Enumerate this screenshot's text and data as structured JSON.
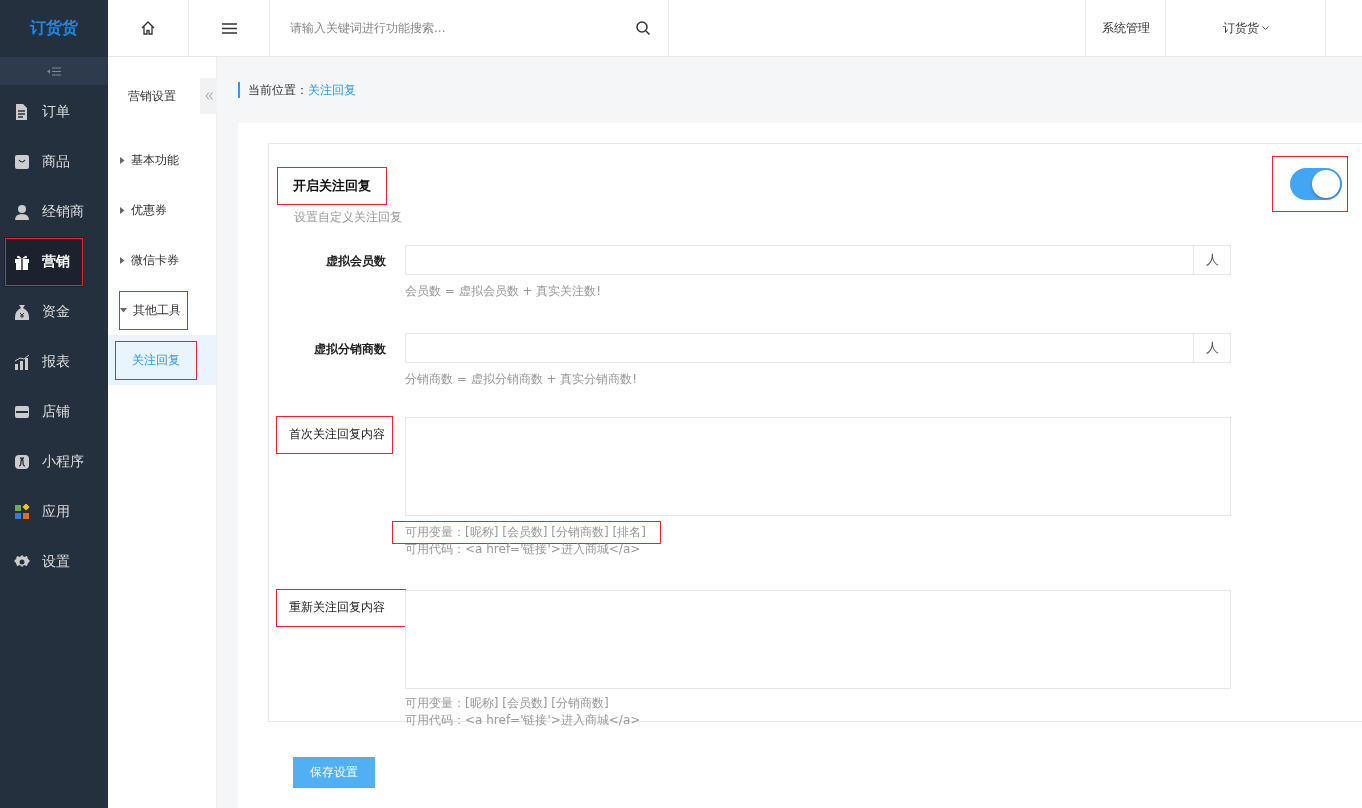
{
  "logo": "订货货",
  "sidebar": {
    "items": [
      {
        "label": "订单",
        "selected": false,
        "highlighted": false
      },
      {
        "label": "商品",
        "selected": false,
        "highlighted": false
      },
      {
        "label": "经销商",
        "selected": false,
        "highlighted": false
      },
      {
        "label": "营销",
        "selected": true,
        "highlighted": true
      },
      {
        "label": "资金",
        "selected": false,
        "highlighted": false
      },
      {
        "label": "报表",
        "selected": false,
        "highlighted": false
      },
      {
        "label": "店铺",
        "selected": false,
        "highlighted": false
      },
      {
        "label": "小程序",
        "selected": false,
        "highlighted": false
      },
      {
        "label": "应用",
        "selected": false,
        "highlighted": false
      },
      {
        "label": "设置",
        "selected": false,
        "highlighted": false
      }
    ]
  },
  "topbar": {
    "search": {
      "placeholder": "请输入关键词进行功能搜索..."
    },
    "links": [
      {
        "label": "系统管理",
        "dropdown": false
      },
      {
        "label": "订货货",
        "dropdown": true
      }
    ]
  },
  "submenu": {
    "title": "营销设置",
    "groups": [
      {
        "label": "基本功能",
        "expanded": false,
        "highlighted": false
      },
      {
        "label": "优惠券",
        "expanded": false,
        "highlighted": false
      },
      {
        "label": "微信卡券",
        "expanded": false,
        "highlighted": false
      },
      {
        "label": "其他工具",
        "expanded": true,
        "highlighted": true,
        "children": [
          {
            "label": "关注回复",
            "selected": true,
            "highlighted": true
          }
        ]
      }
    ]
  },
  "breadcrumb": {
    "label": "当前位置：",
    "current": "关注回复"
  },
  "section": {
    "title": "开启关注回复",
    "title_highlighted": true,
    "subtitle": "设置自定义关注回复",
    "toggle": {
      "on": true,
      "highlighted": true
    }
  },
  "fields": [
    {
      "kind": "number",
      "label": "虚拟会员数",
      "label_highlighted": false,
      "unit": "人",
      "hints": [
        {
          "text": "会员数 = 虚拟会员数 + 真实关注数!",
          "highlighted": false
        }
      ]
    },
    {
      "kind": "number",
      "label": "虚拟分销商数",
      "label_highlighted": false,
      "unit": "人",
      "hints": [
        {
          "text": "分销商数 = 虚拟分销商数 + 真实分销商数!",
          "highlighted": false
        }
      ]
    },
    {
      "kind": "textarea",
      "label": "首次关注回复内容",
      "label_highlighted": true,
      "hints": [
        {
          "text": "可用变量：[昵称] [会员数] [分销商数] [排名]",
          "highlighted": true
        },
        {
          "text": "可用代码：<a href='链接'>进入商城</a>",
          "highlighted": false
        }
      ]
    },
    {
      "kind": "textarea",
      "label": "重新关注回复内容",
      "label_highlighted": true,
      "hints": [
        {
          "text": "可用变量：[昵称] [会员数] [分销商数]",
          "highlighted": false
        },
        {
          "text": "可用代码：<a href='链接'>进入商城</a>",
          "highlighted": false
        }
      ]
    }
  ],
  "save_button": "保存设置"
}
